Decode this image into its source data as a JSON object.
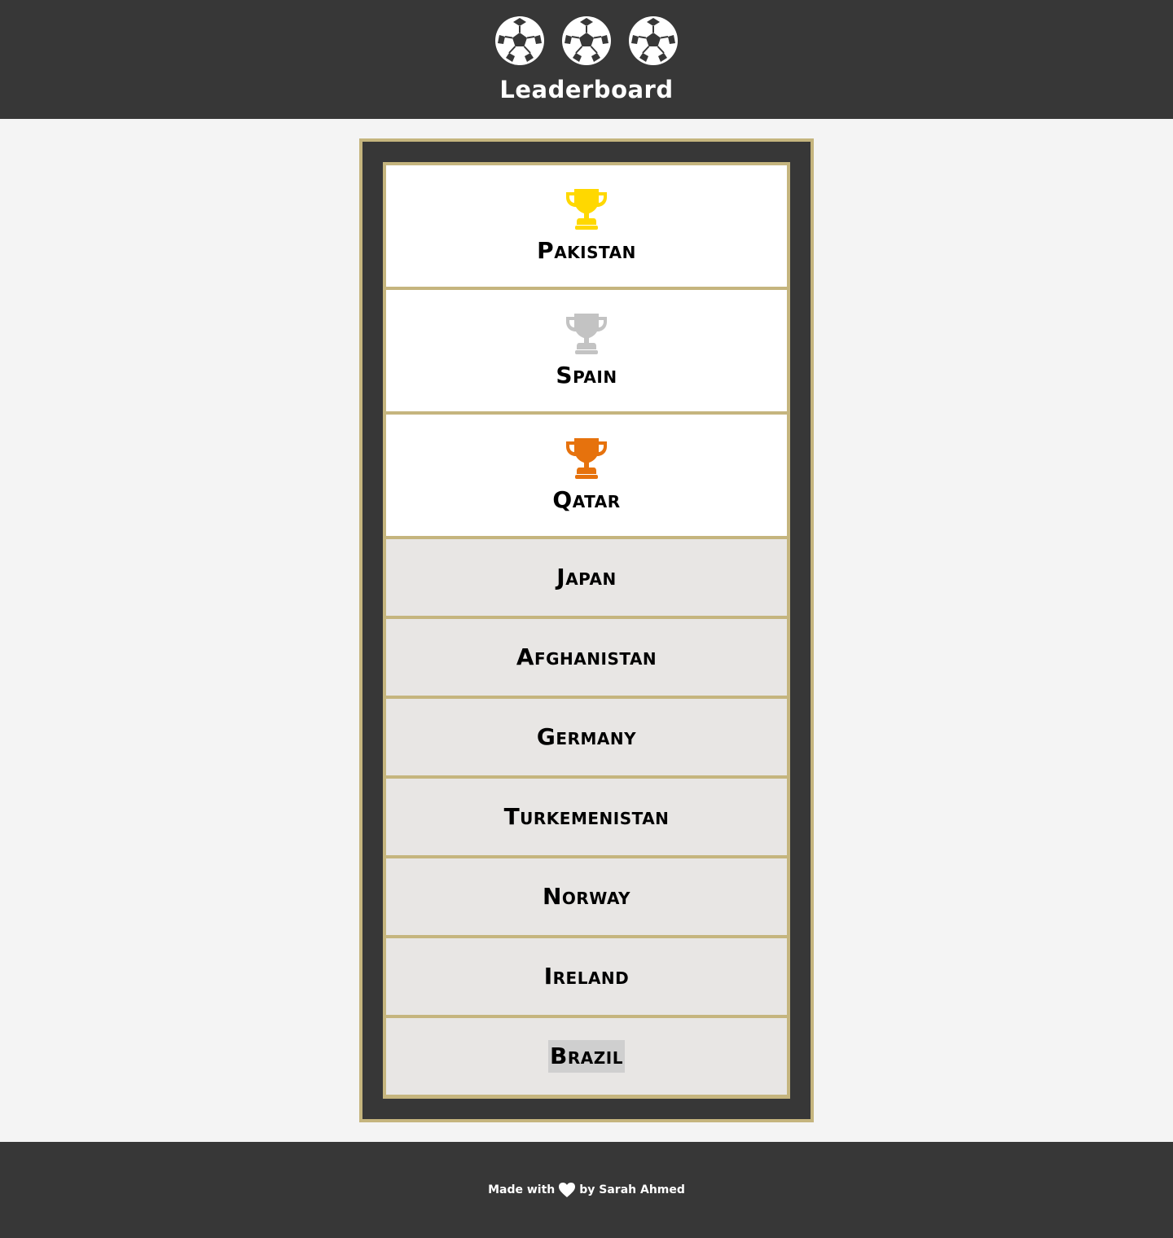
{
  "header": {
    "icons": [
      "soccer-ball-icon",
      "soccer-ball-icon",
      "soccer-ball-icon"
    ],
    "title": "Leaderboard"
  },
  "leaderboard": {
    "top": [
      {
        "name": "Pakistan",
        "trophy_color": "#ffd800",
        "icon": "gold-trophy-icon"
      },
      {
        "name": "Spain",
        "trophy_color": "#c3c3c3",
        "icon": "silver-trophy-icon"
      },
      {
        "name": "Qatar",
        "trophy_color": "#e6720d",
        "icon": "bronze-trophy-icon"
      }
    ],
    "rest": [
      {
        "name": "Japan"
      },
      {
        "name": "Afghanistan"
      },
      {
        "name": "Germany"
      },
      {
        "name": "Turkemenistan"
      },
      {
        "name": "Norway"
      },
      {
        "name": "Ireland"
      },
      {
        "name": "Brazil"
      }
    ]
  },
  "footer": {
    "made_with": "Made with",
    "by_text": "by Sarah Ahmed",
    "icon": "heart-icon"
  },
  "colors": {
    "dark": "#373737",
    "gold_border": "#c5b57e",
    "row_bg": "#e8e6e4",
    "page_bg": "#f4f4f4"
  }
}
